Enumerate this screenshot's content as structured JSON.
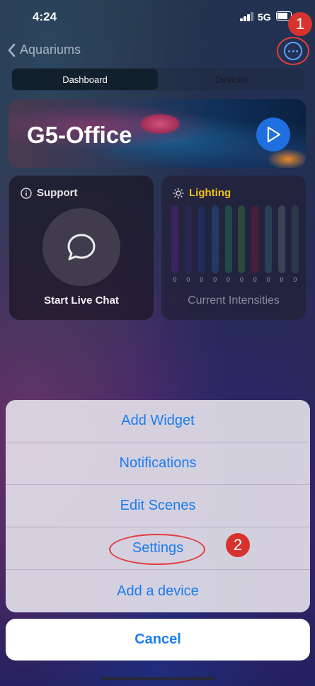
{
  "status_bar": {
    "time": "4:24",
    "network": "5G"
  },
  "nav": {
    "back_label": "Aquariums"
  },
  "tabs": [
    {
      "label": "Dashboard",
      "active": true
    },
    {
      "label": "Devices",
      "active": false
    }
  ],
  "banner": {
    "title": "G5-Office"
  },
  "support_card": {
    "title": "Support",
    "action": "Start Live Chat"
  },
  "lighting_card": {
    "title": "Lighting",
    "footer": "Current Intensities",
    "title_color": "#f2c318",
    "channels": [
      {
        "value": "0",
        "color": "#3a2460"
      },
      {
        "value": "0",
        "color": "#2a2650"
      },
      {
        "value": "0",
        "color": "#1f2c5a"
      },
      {
        "value": "0",
        "color": "#223a66"
      },
      {
        "value": "0",
        "color": "#1f4a4a"
      },
      {
        "value": "0",
        "color": "#2a4a3a"
      },
      {
        "value": "0",
        "color": "#4a1f3a"
      },
      {
        "value": "0",
        "color": "#2a3e54"
      },
      {
        "value": "0",
        "color": "#3a4254"
      },
      {
        "value": "0",
        "color": "#2a3a4a"
      }
    ]
  },
  "action_sheet": {
    "items": [
      "Add Widget",
      "Notifications",
      "Edit Scenes",
      "Settings",
      "Add a device"
    ],
    "cancel": "Cancel"
  },
  "annotations": {
    "step1": "1",
    "step2": "2"
  },
  "colors": {
    "accent": "#1b7cf0",
    "annotation": "#d8322e"
  }
}
